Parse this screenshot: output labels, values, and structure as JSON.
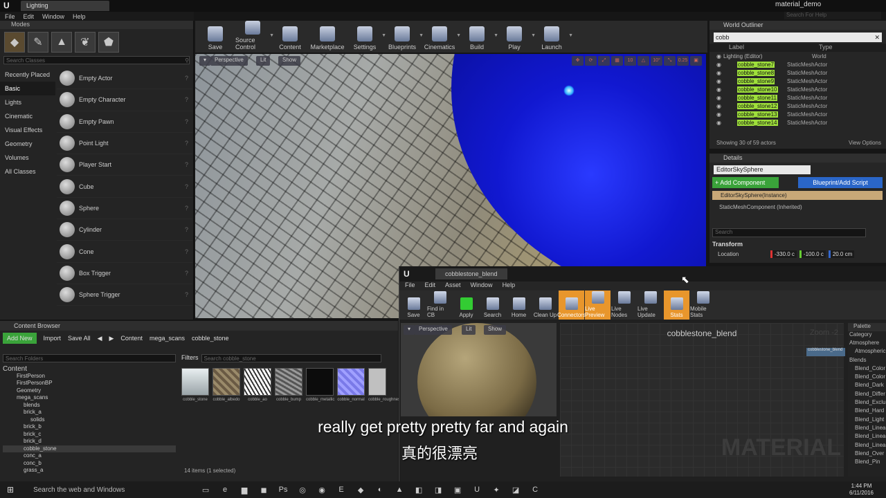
{
  "window": {
    "tab_title": "Lighting",
    "project": "material_demo",
    "help_search": "Search For Help"
  },
  "menu": [
    "File",
    "Edit",
    "Window",
    "Help"
  ],
  "modes": {
    "title": "Modes",
    "search_placeholder": "Search Classes",
    "categories": [
      "Recently Placed",
      "Basic",
      "Lights",
      "Cinematic",
      "Visual Effects",
      "Geometry",
      "Volumes",
      "All Classes"
    ],
    "actors": [
      "Empty Actor",
      "Empty Character",
      "Empty Pawn",
      "Point Light",
      "Player Start",
      "Cube",
      "Sphere",
      "Cylinder",
      "Cone",
      "Box Trigger",
      "Sphere Trigger"
    ]
  },
  "toolbar": [
    "Save",
    "Source Control",
    "Content",
    "Marketplace",
    "Settings",
    "Blueprints",
    "Cinematics",
    "Build",
    "Play",
    "Launch"
  ],
  "viewport": {
    "perspective": "Perspective",
    "lit": "Lit",
    "show": "Show",
    "zoom": "0.25",
    "angle": "10°",
    "grid": "10"
  },
  "outliner": {
    "title": "World Outliner",
    "search": "cobb",
    "col_label": "Label",
    "col_type": "Type",
    "root": "Lighting (Editor)",
    "root_type": "World",
    "rows": [
      {
        "label": "cobble_stone7",
        "type": "StaticMeshActor"
      },
      {
        "label": "cobble_stone8",
        "type": "StaticMeshActor"
      },
      {
        "label": "cobble_stone9",
        "type": "StaticMeshActor"
      },
      {
        "label": "cobble_stone10",
        "type": "StaticMeshActor"
      },
      {
        "label": "cobble_stone11",
        "type": "StaticMeshActor"
      },
      {
        "label": "cobble_stone12",
        "type": "StaticMeshActor"
      },
      {
        "label": "cobble_stone13",
        "type": "StaticMeshActor"
      },
      {
        "label": "cobble_stone14",
        "type": "StaticMeshActor"
      }
    ],
    "footer": "Showing 30 of 59 actors",
    "view_options": "View Options"
  },
  "details": {
    "title": "Details",
    "name": "EditorSkySphere",
    "add_component": "+ Add Component",
    "blueprint": "Blueprint/Add Script",
    "instance": "EditorSkySphere(Instance)",
    "component": "StaticMeshComponent (Inherited)",
    "search_placeholder": "Search",
    "transform": "Transform",
    "location": "Location",
    "x": "-330.0 c",
    "y": "-100.0 c",
    "z": "20.0 cm"
  },
  "content_browser": {
    "title": "Content Browser",
    "add_new": "Add New",
    "import": "Import",
    "save_all": "Save All",
    "path": [
      "Content",
      "mega_scans",
      "cobble_stone"
    ],
    "search_folders": "Search Folders",
    "filters": "Filters",
    "search_assets": "Search cobble_stone",
    "tree": [
      "Content",
      "FirstPerson",
      "FirstPersonBP",
      "Geometry",
      "mega_scans",
      "blends",
      "brick_a",
      "solids",
      "brick_b",
      "brick_c",
      "brick_d",
      "cobble_stone",
      "conc_a",
      "conc_b",
      "grass_a"
    ],
    "assets": [
      "cobble_stone",
      "cobble_albedo",
      "cobble_ao",
      "cobble_bump",
      "cobble_metallic",
      "cobble_normal",
      "cobble_roughness"
    ],
    "items": "14 items (1 selected)"
  },
  "material_editor": {
    "tab": "cobblestone_blend",
    "menu": [
      "File",
      "Edit",
      "Asset",
      "Window",
      "Help"
    ],
    "tools": [
      "Save",
      "Find in CB",
      "Apply",
      "Search",
      "Home",
      "Clean Up",
      "Connectors",
      "Live Preview",
      "Live Nodes",
      "Live Update",
      "Stats",
      "Mobile Stats"
    ],
    "graph_title": "cobblestone_blend",
    "zoom": "Zoom -2",
    "watermark": "MATERIAL",
    "palette_title": "Palette",
    "category": "Category",
    "palette": [
      "Atmosphere",
      "Atmospheric",
      "Blends",
      "Blend_Color",
      "Blend_Color",
      "Blend_Dark",
      "Blend_Differ",
      "Blend_Exclu",
      "Blend_Hard",
      "Blend_Light",
      "Blend_Linea",
      "Blend_Linea",
      "Blend_Linea",
      "Blend_Over",
      "Blend_Pin"
    ]
  },
  "subtitle": {
    "en": "really get pretty pretty far and again",
    "zh": "真的很漂亮"
  },
  "taskbar": {
    "search": "Search the web and Windows",
    "time": "1:44 PM",
    "date": "6/11/2016"
  }
}
